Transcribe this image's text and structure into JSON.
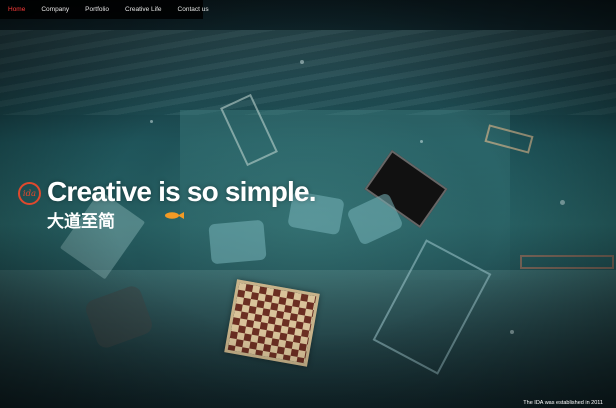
{
  "nav": {
    "items": [
      {
        "label": "Home",
        "active": true
      },
      {
        "label": "Company",
        "active": false
      },
      {
        "label": "Portfolio",
        "active": false
      },
      {
        "label": "Creative Life",
        "active": false
      },
      {
        "label": "Contact us",
        "active": false
      }
    ]
  },
  "hero": {
    "logo_text": "ida",
    "headline": "Creative is so simple.",
    "subheadline": "大道至简",
    "footer_note": "The IDA was established in 2011"
  },
  "colors": {
    "nav_active": "#ff3b3b",
    "logo_accent": "#e0492d",
    "nav_background": "#000000",
    "text": "#ffffff"
  },
  "icons": {
    "logo": "ida-logo-icon"
  }
}
